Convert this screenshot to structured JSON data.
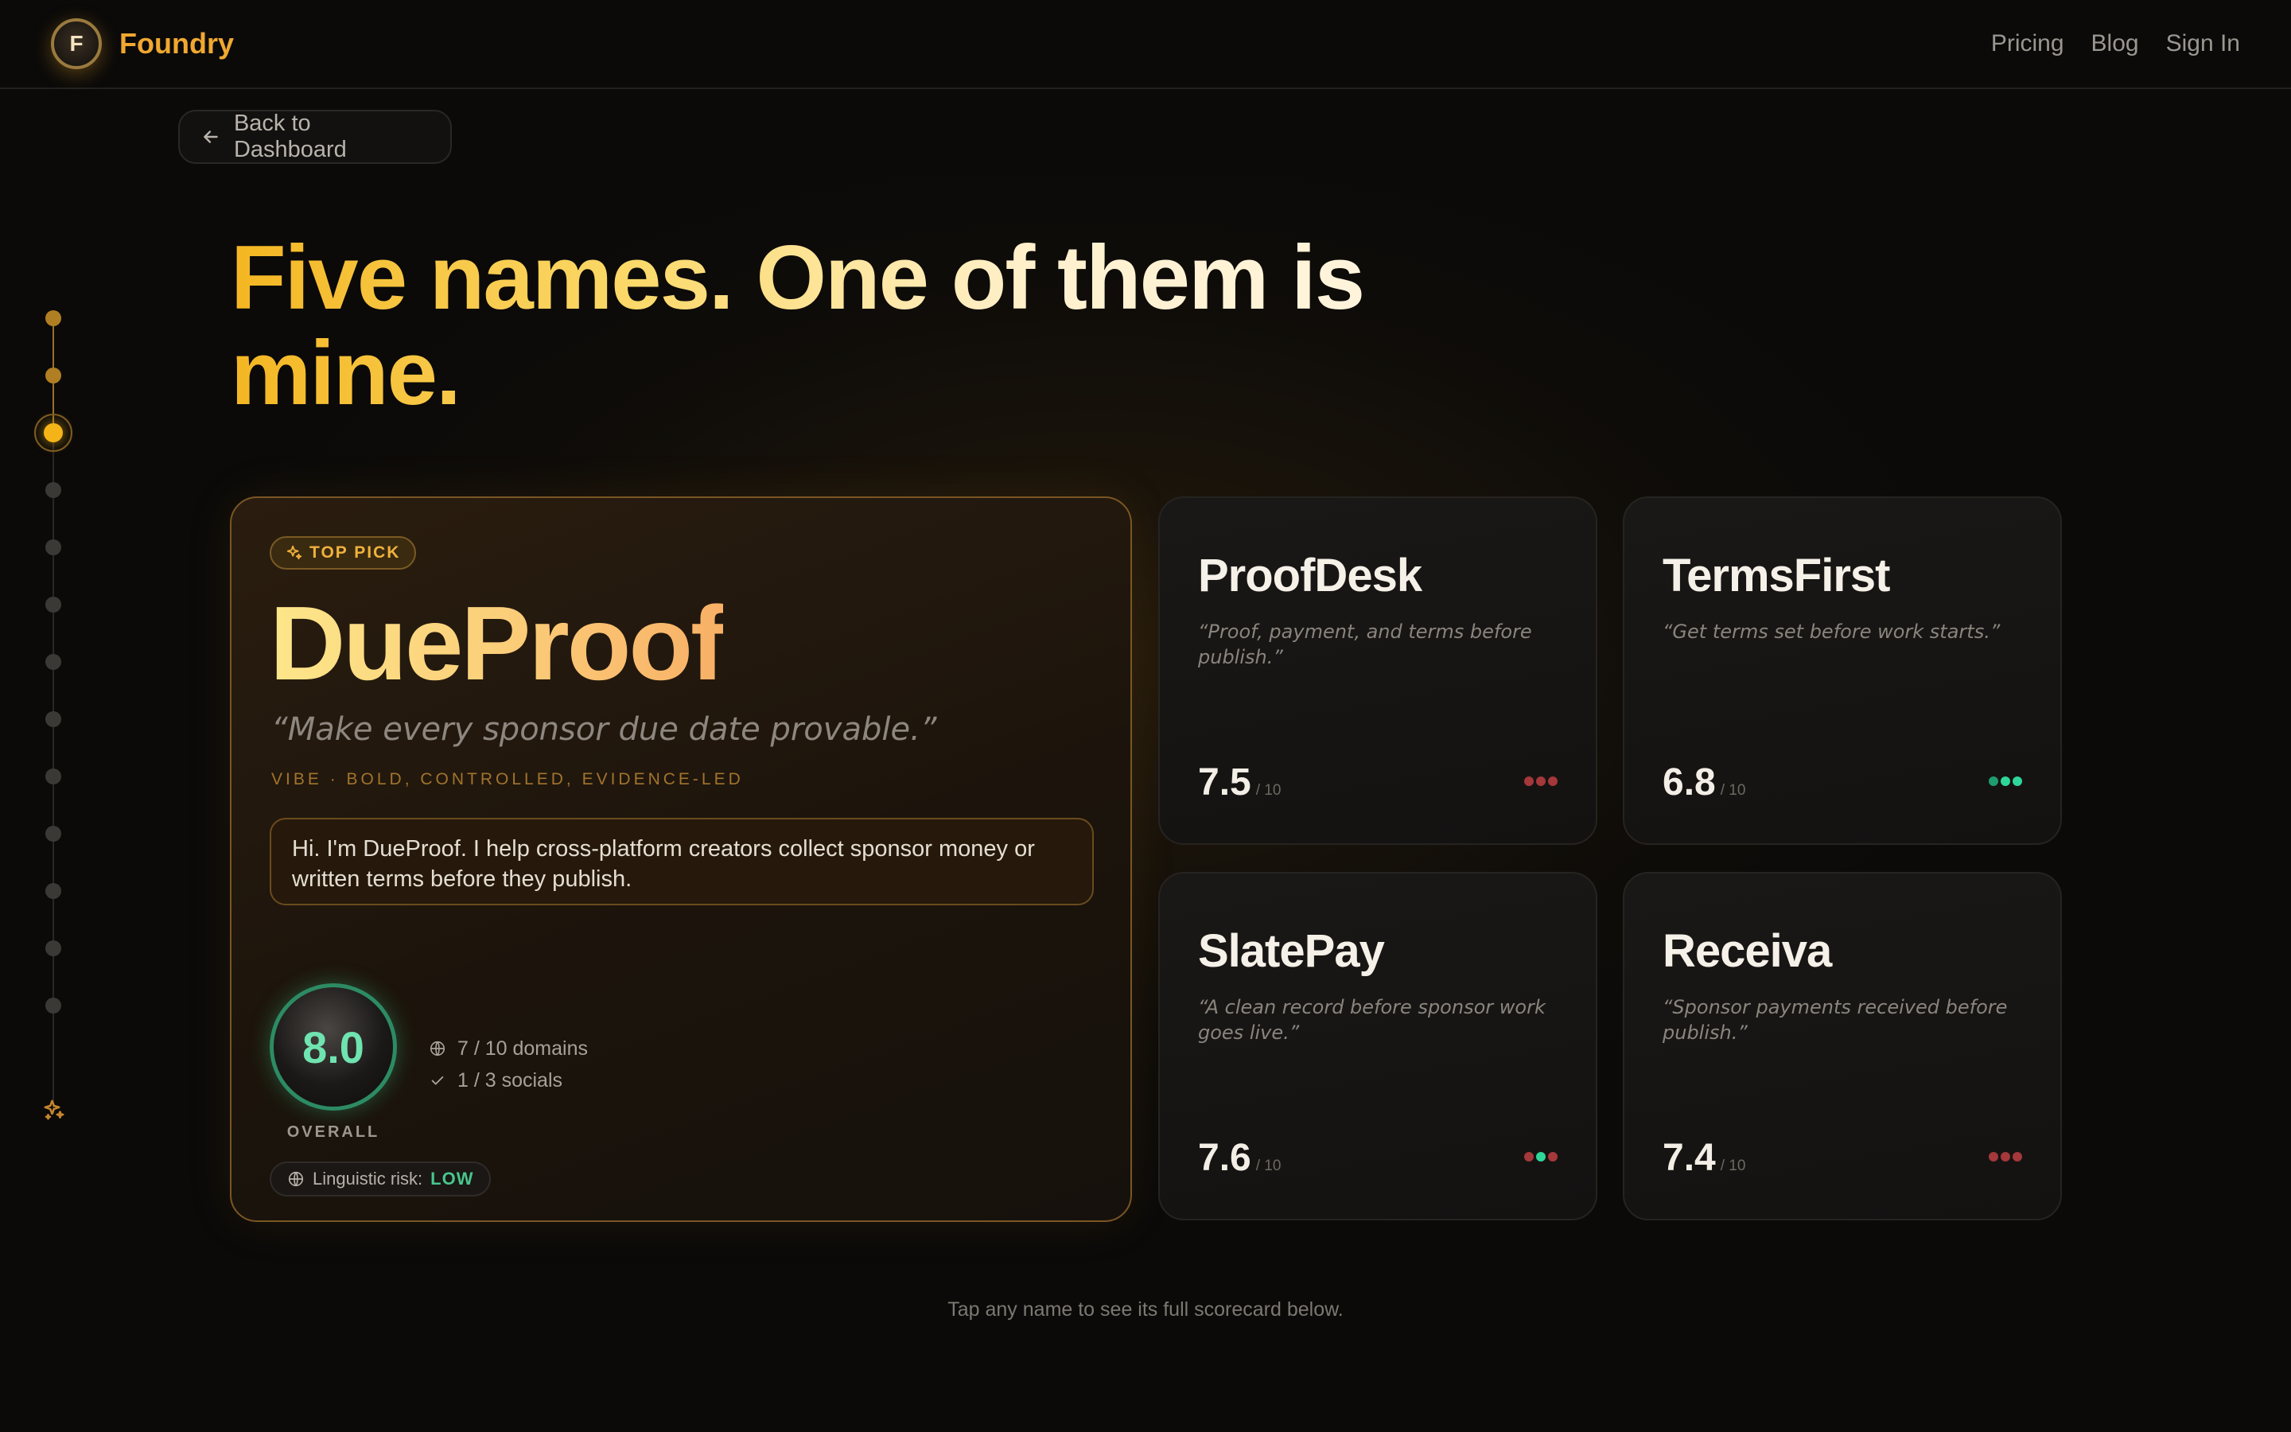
{
  "app": {
    "name": "Foundry",
    "logo_letter": "F"
  },
  "nav": {
    "items": [
      "Pricing",
      "Blog",
      "Sign In"
    ]
  },
  "back_button": {
    "label": "Back to Dashboard"
  },
  "stepper": {
    "total_steps": 13,
    "current_step": 3
  },
  "headline": "Five names. One of them is mine.",
  "top_pick": {
    "badge": "TOP PICK",
    "name": "DueProof",
    "tagline": "“Make every sponsor due date provable.”",
    "vibe": "VIBE · BOLD, CONTROLLED, EVIDENCE-LED",
    "intro": "Hi. I'm DueProof. I help cross-platform creators collect sponsor money or written terms before they publish.",
    "score": "8.0",
    "score_label": "OVERALL",
    "domains": "7 / 10 domains",
    "socials": "1 / 3 socials",
    "risk_label": "Linguistic risk:",
    "risk_value": "LOW"
  },
  "alternatives": [
    {
      "name": "ProofDesk",
      "tagline": "“Proof, payment, and terms before publish.”",
      "score": "7.5",
      "out_of": "/ 10",
      "dots": [
        "#a4383a",
        "#a4383a",
        "#a4383a"
      ]
    },
    {
      "name": "TermsFirst",
      "tagline": "“Get terms set before work starts.”",
      "score": "6.8",
      "out_of": "/ 10",
      "dots": [
        "#1f9b70",
        "#2fd69a",
        "#2fd69a"
      ]
    },
    {
      "name": "SlatePay",
      "tagline": "“A clean record before sponsor work goes live.”",
      "score": "7.6",
      "out_of": "/ 10",
      "dots": [
        "#a4383a",
        "#2fd69a",
        "#a4383a"
      ]
    },
    {
      "name": "Receiva",
      "tagline": "“Sponsor payments received before publish.”",
      "score": "7.4",
      "out_of": "/ 10",
      "dots": [
        "#a4383a",
        "#a4383a",
        "#a4383a"
      ]
    }
  ],
  "footer_hint": "Tap any name to see its full scorecard below.",
  "colors": {
    "accent": "#f0a830",
    "good": "#48c58d",
    "bad": "#a4383a",
    "background": "#0b0a09"
  }
}
